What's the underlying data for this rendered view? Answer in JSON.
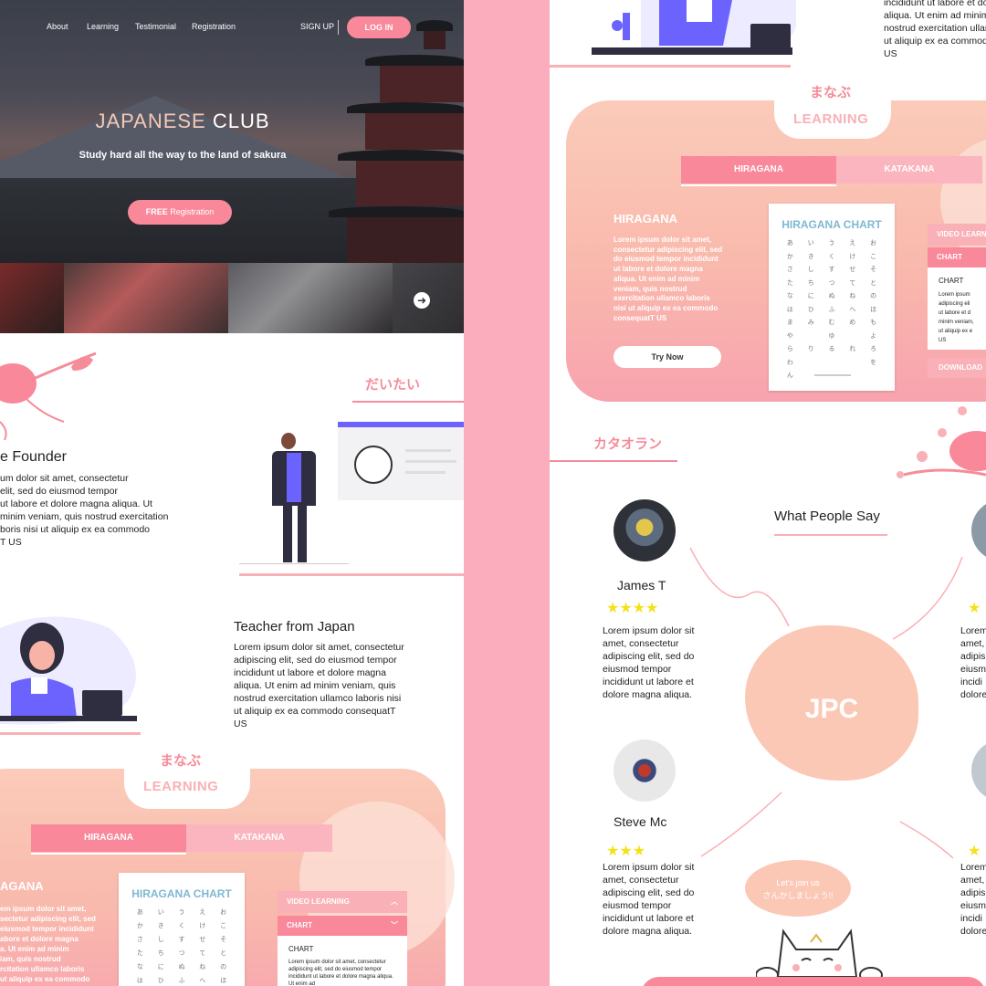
{
  "nav": {
    "items": [
      "About",
      "Learning",
      "Testimonial",
      "Registration"
    ],
    "signup": "SIGN UP",
    "login": "LOG IN"
  },
  "hero": {
    "title_a": "JAPANESE",
    "title_b": "CLUB",
    "subtitle": "Study hard all the way to the land of sakura",
    "cta_bold": "FREE",
    "cta_rest": "Registration"
  },
  "about": {
    "kana": "だいたい",
    "founder_title": "e Founder",
    "founder_text": "um dolor sit amet, consectetur\nelit, sed do eiusmod tempor\nut labore et dolore magna aliqua. Ut\nminim veniam, quis nostrud exercitation\nboris nisi ut aliquip ex ea commodo\nT US",
    "teacher_title": "Teacher from Japan",
    "teacher_text": "Lorem ipsum dolor sit amet, consectetur\nadipiscing elit, sed do eiusmod tempor\nincididunt ut labore et dolore magna\naliqua. Ut enim ad minim veniam, quis\nnostrud exercitation ullamco laboris nisi\nut aliquip ex ea commodo consequatT\nUS"
  },
  "learning": {
    "kana": "まなぶ",
    "title": "LEARNING",
    "tab_hiragana": "HIRAGANA",
    "tab_katakana": "KATAKANA",
    "section_title": "HIRAGANA",
    "left_section_title": "AGANA",
    "section_text": "Lorem ipsum dolor sit amet,\nconsectetur adipiscing elit, sed\ndo eiusmod tempor incididunt\nut labore et dolore magna\naliqua. Ut enim ad minim\nveniam, quis nostrud\nexercitation ullamco laboris\nnisi ut aliquip ex ea commodo\nconsequatT US",
    "left_section_text": "em ipsum dolor sit amet,\nsectetur adipiscing elit, sed\neiusmod tempor incididunt\nabore et dolore magna\na. Ut enim ad minim\niam, quis nostrud\nrcitation ullamco laboris\nut aliquip ex ea commodo",
    "try_now": "Try Now",
    "chart_title": "HIRAGANA CHART",
    "chart_rows": [
      [
        "あ",
        "い",
        "う",
        "え",
        "お"
      ],
      [
        "か",
        "き",
        "く",
        "け",
        "こ"
      ],
      [
        "さ",
        "し",
        "す",
        "せ",
        "そ"
      ],
      [
        "た",
        "ち",
        "つ",
        "て",
        "と"
      ],
      [
        "な",
        "に",
        "ぬ",
        "ね",
        "の"
      ],
      [
        "は",
        "ひ",
        "ふ",
        "へ",
        "ほ"
      ],
      [
        "ま",
        "み",
        "む",
        "め",
        "も"
      ],
      [
        "や",
        "",
        "ゆ",
        "",
        "よ"
      ],
      [
        "ら",
        "り",
        "る",
        "れ",
        "ろ"
      ],
      [
        "わ",
        "",
        "",
        "",
        "を"
      ],
      [
        "ん",
        "",
        "",
        "",
        ""
      ]
    ],
    "acc_video": "VIDEO LEARNING",
    "acc_video_right": "VIDEO LEARN",
    "acc_chart": "CHART",
    "acc_chart_body_title": "CHART",
    "acc_chart_body_text": "Lorem ipsum dolor sit amet, consectetur adipiscing elit, sed do eiusmod tempor incididunt ut labore et dolore magna aliqua. Ut enim ad",
    "acc_chart_body_text_right": "Lorem ipsum\nadipiscing eli\nut labore et d\nminim veniam,\nut aliquip ex e\nUS",
    "download": "DOWNLOAD"
  },
  "top_right_text": "incididunt ut labore et dolore magna\naliqua. Ut enim ad minim veniam, quis\nnostrud exercitation ullamco laboris nisi\nut aliquip ex ea commodo consequatT\nUS",
  "testimonial": {
    "kana": "カタオラン",
    "title": "What People Say",
    "center": "JPC",
    "bubble": "Let's join us\nさんかしましょう!!",
    "people": [
      {
        "name": "James T",
        "stars": 4,
        "text": "Lorem ipsum dolor sit\namet, consectetur\nadipiscing elit, sed do\neiusmod tempor\nincididunt ut labore et\ndolore magna aliqua."
      },
      {
        "name": "Steve Mc",
        "stars": 3,
        "text": "Lorem ipsum dolor sit\namet, consectetur\nadipiscing elit, sed do\neiusmod tempor\nincididunt ut labore et\ndolore magna aliqua."
      }
    ],
    "cut_text_1": "Lorem\namet,\nadipis\neiusm\nincidi\ndolore",
    "cut_text_2": "Lorem\namet,\nadipis\neiusm\nincidi\ndolore"
  },
  "colors": {
    "accent": "#f9889a",
    "pink_light": "#fbadbe",
    "peach": "#fbc8b6"
  }
}
